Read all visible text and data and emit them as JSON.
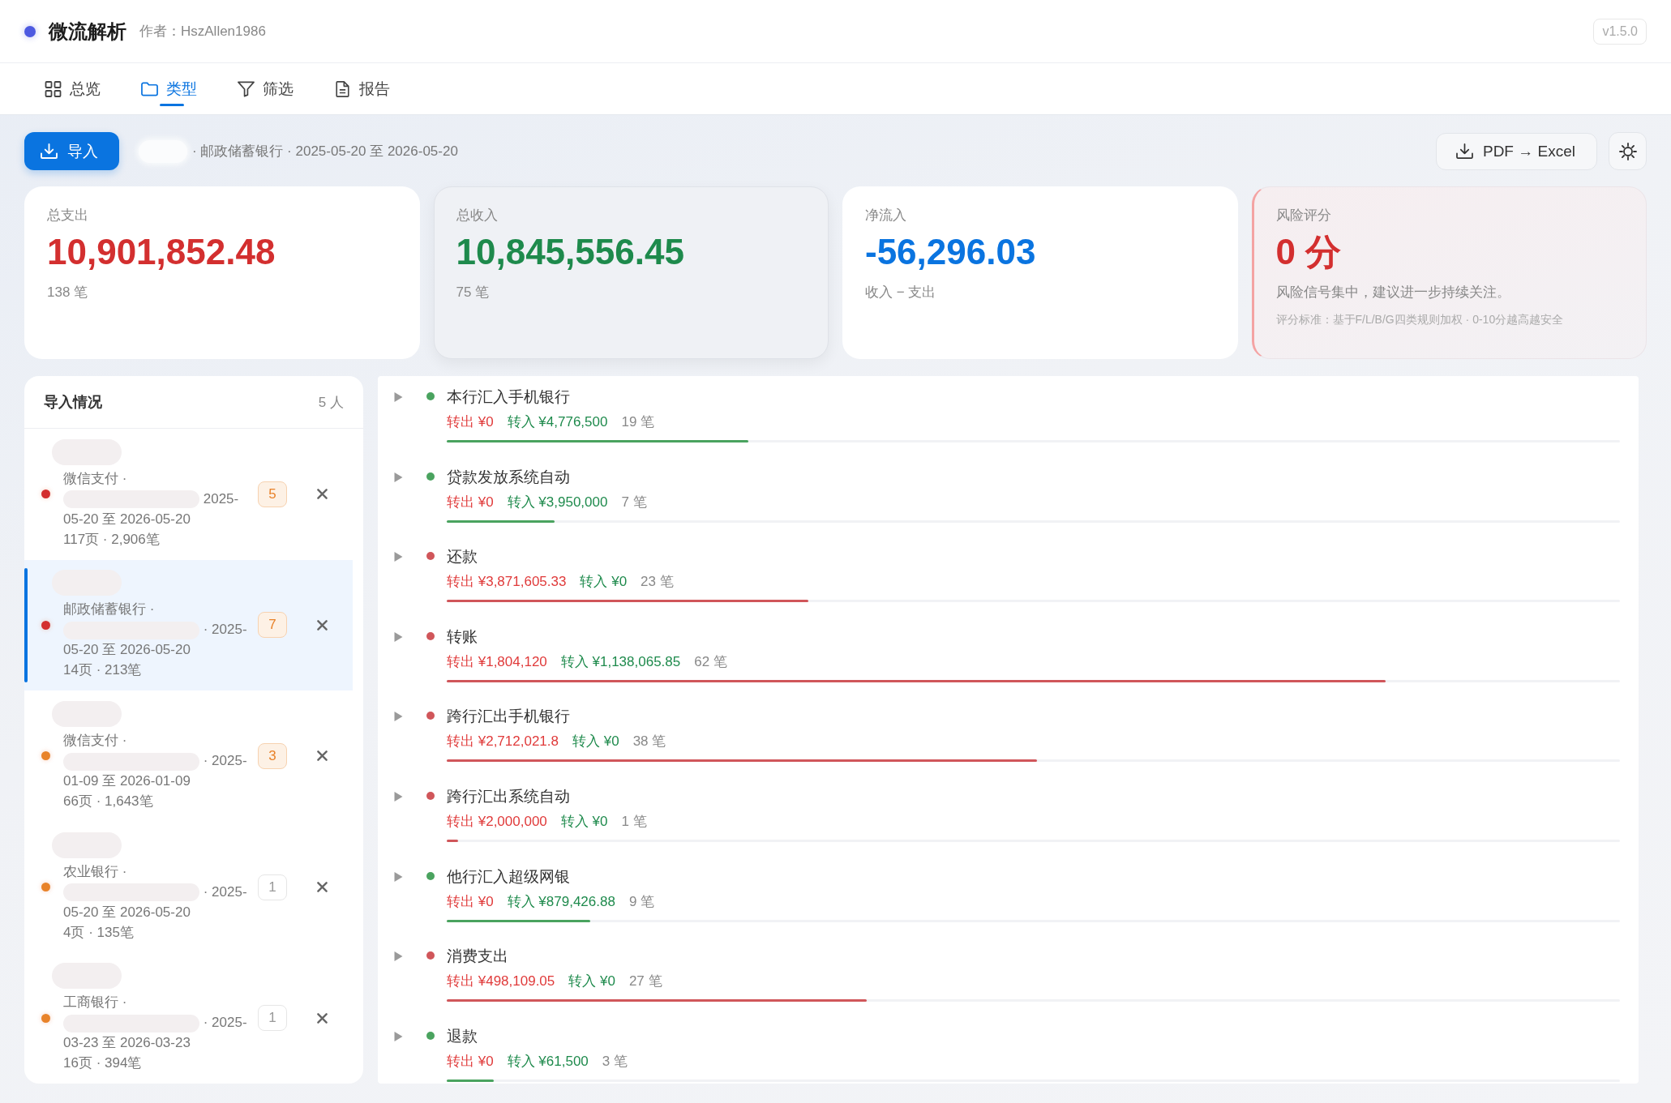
{
  "header": {
    "title": "微流解析",
    "author": "作者：HszAllen1986",
    "version": "v1.5.0"
  },
  "tabs": [
    {
      "kind": "overview",
      "label": "总览",
      "selected": false
    },
    {
      "kind": "category",
      "label": "类型",
      "selected": true
    },
    {
      "kind": "filter",
      "label": "筛选",
      "selected": false
    },
    {
      "kind": "report",
      "label": "报告",
      "selected": false
    }
  ],
  "toolbar": {
    "import_label": "导入",
    "summary": "· 邮政储蓄银行 · 2025-05-20 至 2026-05-20",
    "convert_label": "PDF → Excel"
  },
  "stats": [
    {
      "kind": "expense",
      "label": "总支出",
      "value": "10,901,852.48",
      "note": "138 笔",
      "highlighted": false
    },
    {
      "kind": "income",
      "label": "总收入",
      "value": "10,845,556.45",
      "note": "75 笔",
      "highlighted": true
    },
    {
      "kind": "net",
      "label": "净流入",
      "value": "-56,296.03",
      "note": "收入 − 支出",
      "highlighted": false
    },
    {
      "kind": "risk",
      "label": "风险评分",
      "value": "0 分",
      "note": "风险信号集中，建议进一步持续关注。",
      "footnote": "评分标准：基于F/L/B/G四类规则加权 · 0-10分越高越安全",
      "highlighted": false
    }
  ],
  "imports": {
    "title": "导入情况",
    "count": "5 人",
    "items": [
      {
        "color": "#d32f2f",
        "source": "微信支付 ·",
        "period": "2025-05-20 至 2026-05-20",
        "pages": "117页 · 2,906笔",
        "badge": "5",
        "flagged": true,
        "selected": false
      },
      {
        "color": "#d32f2f",
        "source": "邮政储蓄银行 ·",
        "period": "· 2025-05-20 至 2026-05-20",
        "pages": "14页 · 213笔",
        "badge": "7",
        "flagged": true,
        "selected": true
      },
      {
        "color": "#e8832a",
        "source": "微信支付 ·",
        "period": "· 2025-01-09 至 2026-01-09",
        "pages": "66页 · 1,643笔",
        "badge": "3",
        "flagged": true,
        "selected": false
      },
      {
        "color": "#e8832a",
        "source": "农业银行 ·",
        "period": "· 2025-05-20 至 2026-05-20",
        "pages": "4页 · 135笔",
        "badge": "1",
        "flagged": false,
        "selected": false
      },
      {
        "color": "#e8832a",
        "source": "工商银行 ·",
        "period": "· 2025-03-23 至 2026-03-23",
        "pages": "16页 · 394笔",
        "badge": "1",
        "flagged": false,
        "selected": false
      }
    ]
  },
  "categories": [
    {
      "name": "本行汇入手机银行",
      "outflow": "转出 ¥0",
      "inflow": "转入 ¥4,776,500",
      "count": "19 笔",
      "color": "#4aa35f",
      "level": 0.257,
      "expanded": false
    },
    {
      "name": "贷款发放系统自动",
      "outflow": "转出 ¥0",
      "inflow": "转入 ¥3,950,000",
      "count": "7 笔",
      "color": "#4aa35f",
      "level": 0.092,
      "expanded": false
    },
    {
      "name": "还款",
      "outflow": "转出 ¥3,871,605.33",
      "inflow": "转入 ¥0",
      "count": "23 笔",
      "color": "#d0565a",
      "level": 0.308,
      "expanded": false
    },
    {
      "name": "转账",
      "outflow": "转出 ¥1,804,120",
      "inflow": "转入 ¥1,138,065.85",
      "count": "62 笔",
      "color": "#d0565a",
      "level": 0.8,
      "expanded": false
    },
    {
      "name": "跨行汇出手机银行",
      "outflow": "转出 ¥2,712,021.8",
      "inflow": "转入 ¥0",
      "count": "38 笔",
      "color": "#d0565a",
      "level": 0.503,
      "expanded": false
    },
    {
      "name": "跨行汇出系统自动",
      "outflow": "转出 ¥2,000,000",
      "inflow": "转入 ¥0",
      "count": "1 笔",
      "color": "#d0565a",
      "level": 0.01,
      "expanded": false
    },
    {
      "name": "他行汇入超级网银",
      "outflow": "转出 ¥0",
      "inflow": "转入 ¥879,426.88",
      "count": "9 笔",
      "color": "#4aa35f",
      "level": 0.122,
      "expanded": false
    },
    {
      "name": "消费支出",
      "outflow": "转出 ¥498,109.05",
      "inflow": "转入 ¥0",
      "count": "27 笔",
      "color": "#d0565a",
      "level": 0.358,
      "expanded": false
    },
    {
      "name": "退款",
      "outflow": "转出 ¥0",
      "inflow": "转入 ¥61,500",
      "count": "3 笔",
      "color": "#4aa35f",
      "level": 0.04,
      "expanded": false
    }
  ]
}
